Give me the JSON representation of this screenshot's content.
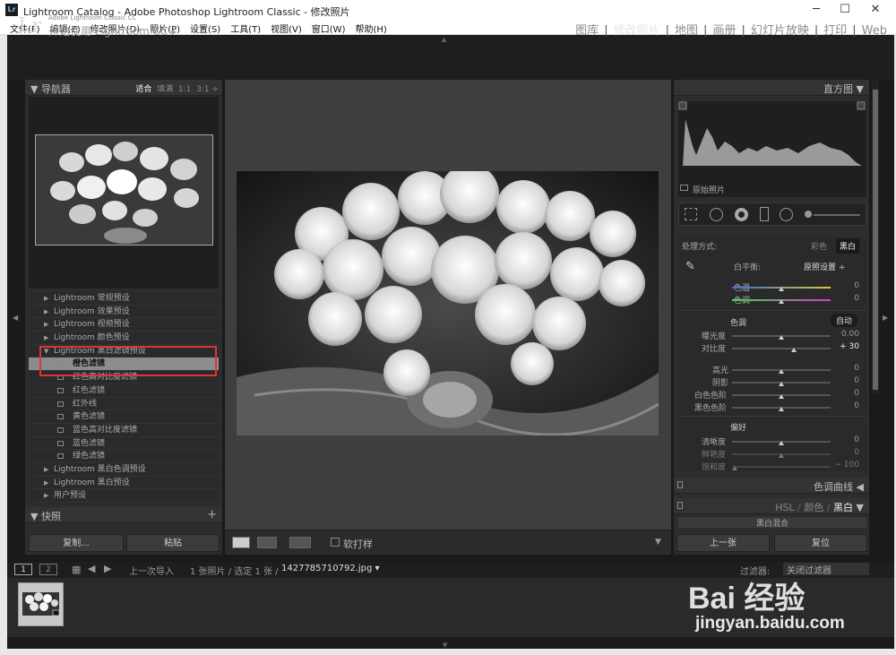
{
  "window": {
    "title": "Lightroom Catalog - Adobe Photoshop Lightroom Classic - 修改照片",
    "icon": "Lr",
    "controls": [
      "─",
      "☐",
      "✕"
    ]
  },
  "menu": [
    "文件(F)",
    "编辑(E)",
    "修改照片(D)",
    "照片(P)",
    "设置(S)",
    "工具(T)",
    "视图(V)",
    "窗口(W)",
    "帮助(H)"
  ],
  "identity": {
    "logo": "Lr",
    "line1": "Adobe Lightroom Classic CC",
    "line2": "开始使用 Lightroom CC ▸"
  },
  "modules": [
    "图库",
    "修改照片",
    "地图",
    "画册",
    "幻灯片放映",
    "打印",
    "Web"
  ],
  "active_module": "修改照片",
  "navigator": {
    "title": "导航器",
    "options": [
      "适合",
      "填满",
      "1:1",
      "3:1 ÷"
    ],
    "selected_option": "适合"
  },
  "presets": [
    {
      "label": "Lightroom 常规预设",
      "type": "folder"
    },
    {
      "label": "Lightroom 效果预设",
      "type": "folder"
    },
    {
      "label": "Lightroom 视频预设",
      "type": "folder"
    },
    {
      "label": "Lightroom 颜色预设",
      "type": "folder"
    },
    {
      "label": "Lightroom 黑白滤镜预设",
      "type": "folder-open"
    },
    {
      "label": "橙色滤镜",
      "type": "leaf",
      "selected": true
    },
    {
      "label": "红色高对比度滤镜",
      "type": "leaf"
    },
    {
      "label": "红色滤镜",
      "type": "leaf"
    },
    {
      "label": "红外线",
      "type": "leaf"
    },
    {
      "label": "黄色滤镜",
      "type": "leaf"
    },
    {
      "label": "蓝色高对比度滤镜",
      "type": "leaf"
    },
    {
      "label": "蓝色滤镜",
      "type": "leaf"
    },
    {
      "label": "绿色滤镜",
      "type": "leaf"
    },
    {
      "label": "Lightroom 黑白色调预设",
      "type": "folder"
    },
    {
      "label": "Lightroom 黑白预设",
      "type": "folder"
    },
    {
      "label": "用户预设",
      "type": "folder"
    }
  ],
  "snapshots": {
    "title": "快照",
    "add": "+"
  },
  "left_buttons": {
    "copy": "复制...",
    "paste": "粘贴"
  },
  "toolbar": {
    "softproof": "软打样"
  },
  "histogram": {
    "title": "直方图",
    "original": "原始照片"
  },
  "basic": {
    "treatment_label": "处理方式:",
    "color": "彩色",
    "bw": "黑白",
    "wb_label": "白平衡:",
    "wb_value": "原照设置 ÷",
    "temp": {
      "label": "色温",
      "value": "0"
    },
    "tint": {
      "label": "色调",
      "value": "0"
    },
    "tone_title": "色调",
    "auto": "自动",
    "exposure": {
      "label": "曝光度",
      "value": "0.00"
    },
    "contrast": {
      "label": "对比度",
      "value": "+ 30"
    },
    "highlights": {
      "label": "高光",
      "value": "0"
    },
    "shadows": {
      "label": "阴影",
      "value": "0"
    },
    "whites": {
      "label": "白色色阶",
      "value": "0"
    },
    "blacks": {
      "label": "黑色色阶",
      "value": "0"
    },
    "presence_title": "偏好",
    "clarity": {
      "label": "清晰度",
      "value": "0"
    },
    "vibrance": {
      "label": "鲜艳度",
      "value": "0"
    },
    "saturation": {
      "label": "饱和度",
      "value": "− 100"
    }
  },
  "tone_curve": "色调曲线",
  "hsl": {
    "hsl": "HSL",
    "color": "颜色",
    "bw": "黑白",
    "mix": "黑白混合"
  },
  "right_buttons": {
    "previous": "上一张",
    "reset": "复位"
  },
  "filmstrip": {
    "pages": [
      "1",
      "2"
    ],
    "source": "上一次导入",
    "count": "1 张照片 / 选定 1 张 /",
    "filename": "1427785710792.jpg ▾",
    "filter_label": "过滤器:",
    "filter_value": "关闭过滤器"
  },
  "watermark": {
    "brand": "Bai 经验",
    "url": "jingyan.baidu.com"
  },
  "colors": {
    "accent_red": "#e03535",
    "panel": "#2d2d2d",
    "background": "#1a1a1a"
  }
}
